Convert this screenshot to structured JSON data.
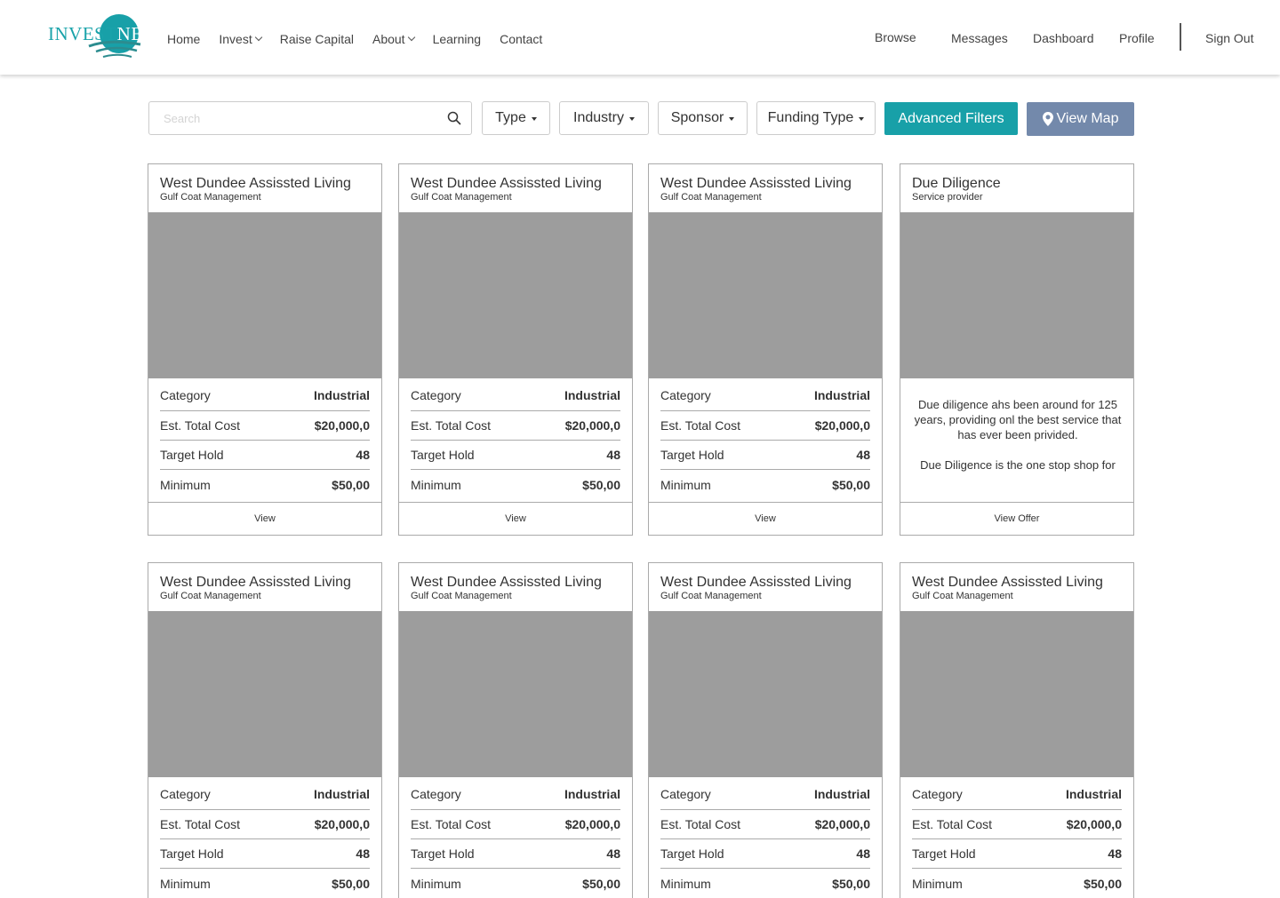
{
  "header": {
    "logo": {
      "invest": "INVEST",
      "nest": "NEST"
    },
    "nav": [
      {
        "label": "Home"
      },
      {
        "label": "Invest",
        "has_dropdown": true
      },
      {
        "label": "Raise Capital"
      },
      {
        "label": "About",
        "has_dropdown": true
      },
      {
        "label": "Learning"
      },
      {
        "label": "Contact"
      }
    ],
    "user_nav": {
      "browse": "Browse",
      "messages": "Messages",
      "dashboard": "Dashboard",
      "profile": "Profile",
      "sign_out": "Sign Out"
    }
  },
  "filters": {
    "search_placeholder": "Search",
    "type": "Type",
    "industry": "Industry",
    "sponsor": "Sponsor",
    "funding_type": "Funding Type",
    "advanced": "Advanced Filters",
    "view_map": "View Map"
  },
  "colors": {
    "brand_teal": "#18a0a8",
    "map_button": "#7389ab",
    "image_placeholder": "#9d9d9d"
  },
  "cards": [
    {
      "title": "West Dundee Assissted Living",
      "subtitle": "Gulf Coat Management",
      "rows": [
        {
          "label": "Category",
          "value": "Industrial"
        },
        {
          "label": "Est. Total Cost",
          "value": "$20,000,0"
        },
        {
          "label": "Target Hold",
          "value": "48"
        },
        {
          "label": "Minimum",
          "value": "$50,00"
        }
      ],
      "action": "View"
    },
    {
      "title": "West Dundee Assissted Living",
      "subtitle": "Gulf Coat Management",
      "rows": [
        {
          "label": "Category",
          "value": "Industrial"
        },
        {
          "label": "Est. Total Cost",
          "value": "$20,000,0"
        },
        {
          "label": "Target Hold",
          "value": "48"
        },
        {
          "label": "Minimum",
          "value": "$50,00"
        }
      ],
      "action": "View"
    },
    {
      "title": "West Dundee Assissted Living",
      "subtitle": "Gulf Coat Management",
      "rows": [
        {
          "label": "Category",
          "value": "Industrial"
        },
        {
          "label": "Est. Total Cost",
          "value": "$20,000,0"
        },
        {
          "label": "Target Hold",
          "value": "48"
        },
        {
          "label": "Minimum",
          "value": "$50,00"
        }
      ],
      "action": "View"
    },
    {
      "title": "Due Diligence",
      "subtitle": "Service provider",
      "description": [
        "Due diligence ahs been around for 125 years, providing onl the best service that has ever been privided.",
        "Due Diligence is the one stop shop for"
      ],
      "action": "View Offer"
    },
    {
      "title": "West Dundee Assissted Living",
      "subtitle": "Gulf Coat Management",
      "rows": [
        {
          "label": "Category",
          "value": "Industrial"
        },
        {
          "label": "Est. Total Cost",
          "value": "$20,000,0"
        },
        {
          "label": "Target Hold",
          "value": "48"
        },
        {
          "label": "Minimum",
          "value": "$50,00"
        }
      ]
    },
    {
      "title": "West Dundee Assissted Living",
      "subtitle": "Gulf Coat Management",
      "rows": [
        {
          "label": "Category",
          "value": "Industrial"
        },
        {
          "label": "Est. Total Cost",
          "value": "$20,000,0"
        },
        {
          "label": "Target Hold",
          "value": "48"
        },
        {
          "label": "Minimum",
          "value": "$50,00"
        }
      ]
    },
    {
      "title": "West Dundee Assissted Living",
      "subtitle": "Gulf Coat Management",
      "rows": [
        {
          "label": "Category",
          "value": "Industrial"
        },
        {
          "label": "Est. Total Cost",
          "value": "$20,000,0"
        },
        {
          "label": "Target Hold",
          "value": "48"
        },
        {
          "label": "Minimum",
          "value": "$50,00"
        }
      ]
    },
    {
      "title": "West Dundee Assissted Living",
      "subtitle": "Gulf Coat Management",
      "rows": [
        {
          "label": "Category",
          "value": "Industrial"
        },
        {
          "label": "Est. Total Cost",
          "value": "$20,000,0"
        },
        {
          "label": "Target Hold",
          "value": "48"
        },
        {
          "label": "Minimum",
          "value": "$50,00"
        }
      ]
    }
  ]
}
